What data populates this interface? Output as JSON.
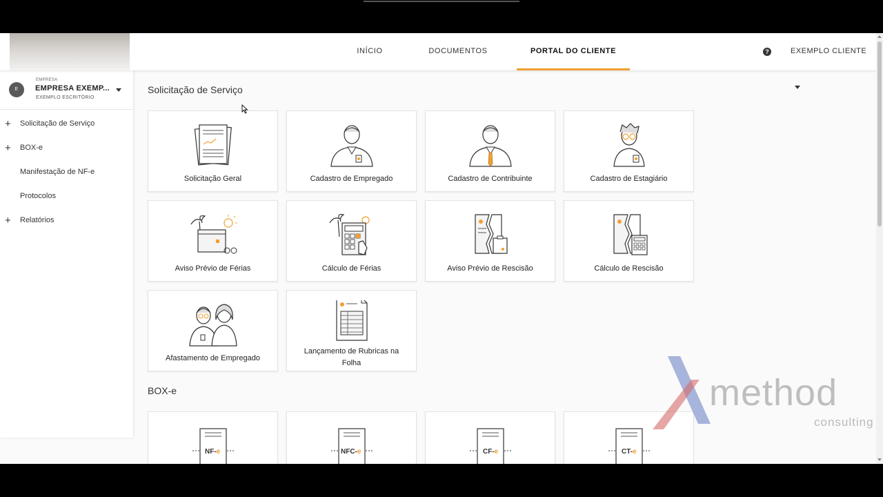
{
  "nav": {
    "items": [
      {
        "label": "INÍCIO"
      },
      {
        "label": "DOCUMENTOS"
      },
      {
        "label": "PORTAL DO CLIENTE"
      }
    ],
    "user_label": "EXEMPLO CLIENTE",
    "accent_color": "#f0a031"
  },
  "sidebar": {
    "company_small": "EMPRESA",
    "company_name": "EMPRESA EXEMP...",
    "company_sub": "EXEMPLO ESCRITÓRIO",
    "avatar_letter": "E",
    "items": [
      {
        "label": "Solicitação de Serviço",
        "expandable": true
      },
      {
        "label": "BOX-e",
        "expandable": true
      },
      {
        "label": "Manifestação de NF-e",
        "expandable": false
      },
      {
        "label": "Protocolos",
        "expandable": false
      },
      {
        "label": "Relatórios",
        "expandable": true
      }
    ]
  },
  "sections": [
    {
      "title": "Solicitação de Serviço",
      "cards": [
        {
          "label": "Solicitação Geral",
          "icon": "documents-icon"
        },
        {
          "label": "Cadastro de Empregado",
          "icon": "employee-icon"
        },
        {
          "label": "Cadastro de Contribuinte",
          "icon": "taxpayer-icon"
        },
        {
          "label": "Cadastro de Estagiário",
          "icon": "intern-icon"
        },
        {
          "label": "Aviso Prévio de Férias",
          "icon": "vacation-notice-icon"
        },
        {
          "label": "Cálculo de Férias",
          "icon": "vacation-calculator-icon"
        },
        {
          "label": "Aviso Prévio de Rescisão",
          "icon": "termination-notice-icon"
        },
        {
          "label": "Cálculo de Rescisão",
          "icon": "termination-calculator-icon"
        },
        {
          "label": "Afastamento de Empregado",
          "icon": "leave-icon"
        },
        {
          "label": "Lançamento de Rubricas na Folha",
          "icon": "payroll-sheet-icon"
        }
      ]
    },
    {
      "title": "BOX-e",
      "cards": [
        {
          "label": "NF-e",
          "icon": "nfe-document-icon"
        },
        {
          "label": "NFC-e",
          "icon": "nfce-document-icon"
        },
        {
          "label": "CF-e",
          "icon": "cfe-document-icon"
        },
        {
          "label": "CT-e",
          "icon": "cte-document-icon"
        }
      ]
    }
  ],
  "watermark": {
    "text": "method",
    "sub": "consulting"
  }
}
